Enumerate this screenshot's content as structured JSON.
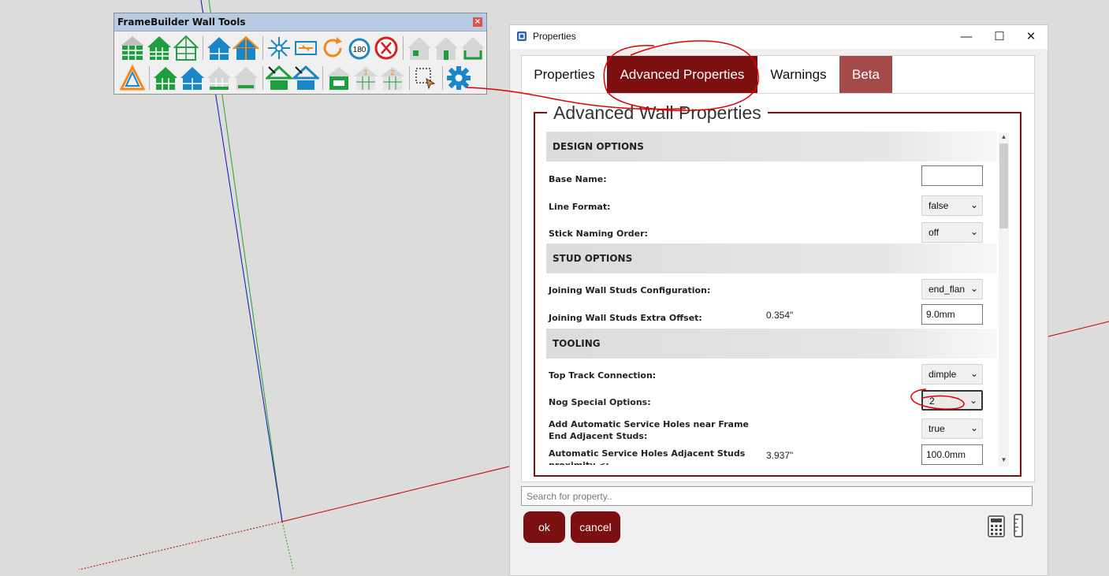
{
  "toolbar": {
    "title": "FrameBuilder Wall Tools",
    "close_glyph": "×",
    "row1_icons": [
      "wall-panel-icon",
      "wall-panel-dark-icon",
      "gable-window-icon",
      "blue-house-icon",
      "blue-house-orange-icon",
      "explode-icon",
      "swap-icon",
      "rotate-icon",
      "rotate-180-icon",
      "delete-icon",
      "house-small-1-icon",
      "house-small-2-icon",
      "house-small-3-icon"
    ],
    "row2_icons": [
      "truss-triangle-icon",
      "green-house-icon",
      "blue-house-2-icon",
      "grey-house-icon",
      "grey-house-flat-icon",
      "roof-edit-green-icon",
      "roof-edit-blue-icon",
      "opening-icon",
      "numbered-1-icon",
      "numbered-2-icon",
      "select-icon",
      "settings-gear-icon"
    ],
    "rotate_label": "180"
  },
  "window": {
    "title": "Properties",
    "controls": {
      "minimize": "—",
      "maximize": "☐",
      "close": "✕"
    }
  },
  "tabs": [
    {
      "label": "Properties",
      "active": false
    },
    {
      "label": "Advanced Properties",
      "active": true
    },
    {
      "label": "Warnings",
      "active": false
    },
    {
      "label": "Beta",
      "active": false
    }
  ],
  "panel": {
    "legend": "Advanced Wall Properties",
    "sections": [
      {
        "title": "DESIGN OPTIONS"
      },
      {
        "title": "STUD OPTIONS"
      },
      {
        "title": "TOOLING"
      }
    ],
    "rows": [
      {
        "label": "Base Name:",
        "control": "input",
        "value": ""
      },
      {
        "label": "Line Format:",
        "control": "select",
        "value": "false"
      },
      {
        "label": "Stick Naming Order:",
        "control": "select",
        "value": "off"
      },
      {
        "label": "Joining Wall Studs Configuration:",
        "control": "select",
        "value": "end_flan"
      },
      {
        "label": "Joining Wall Studs Extra Offset:",
        "control": "input",
        "value": "9.0mm",
        "converted": "0.354\""
      },
      {
        "label": "Top Track Connection:",
        "control": "select",
        "value": "dimple"
      },
      {
        "label": "Nog Special Options:",
        "control": "select",
        "value": "2"
      },
      {
        "label": "Add Automatic Service Holes near Frame End Adjacent Studs:",
        "control": "select",
        "value": "true"
      },
      {
        "label": "Automatic Service Holes Adjacent Studs proximity <:",
        "control": "input",
        "value": "100.0mm",
        "converted": "3.937\""
      }
    ],
    "scroll_up": "▲",
    "scroll_down": "▼",
    "select_chevron": "⌄"
  },
  "search": {
    "placeholder": "Search for property.."
  },
  "buttons": {
    "ok": "ok",
    "cancel": "cancel"
  },
  "colors": {
    "brand": "#7c0f0f",
    "beta_tab": "#a44a4a",
    "annotation": "#e00000",
    "axis_red": "#c00000",
    "axis_green": "#2ca02c",
    "axis_blue": "#1010c0"
  }
}
